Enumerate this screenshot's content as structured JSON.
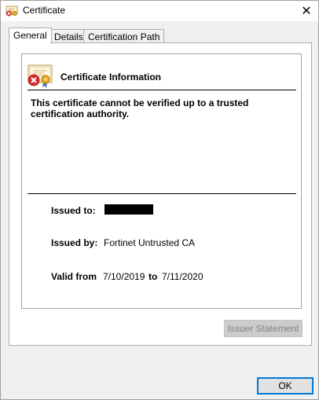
{
  "window": {
    "title": "Certificate",
    "close_glyph": "✕"
  },
  "tabs": [
    {
      "label": "General",
      "active": true
    },
    {
      "label": "Details",
      "active": false
    },
    {
      "label": "Certification Path",
      "active": false
    }
  ],
  "general": {
    "info_title": "Certificate Information",
    "status_message": "This certificate cannot be verified up to a trusted certification authority.",
    "issued_to_label": "Issued to:",
    "issued_to_value_redacted": true,
    "issued_by_label": "Issued by:",
    "issued_by_value": "Fortinet Untrusted CA",
    "valid_from_label": "Valid from",
    "valid_from_value": "7/10/2019",
    "valid_to_label": "to",
    "valid_to_value": "7/11/2020",
    "issuer_statement_label": "Issuer Statement",
    "issuer_statement_enabled": false
  },
  "footer": {
    "ok_label": "OK"
  },
  "icons": {
    "title_icon": "certificate-error-icon",
    "info_icon": "certificate-error-icon"
  },
  "colors": {
    "error_red": "#d42a2a",
    "seal_gold": "#e8a317",
    "focus_blue": "#0078d7"
  }
}
